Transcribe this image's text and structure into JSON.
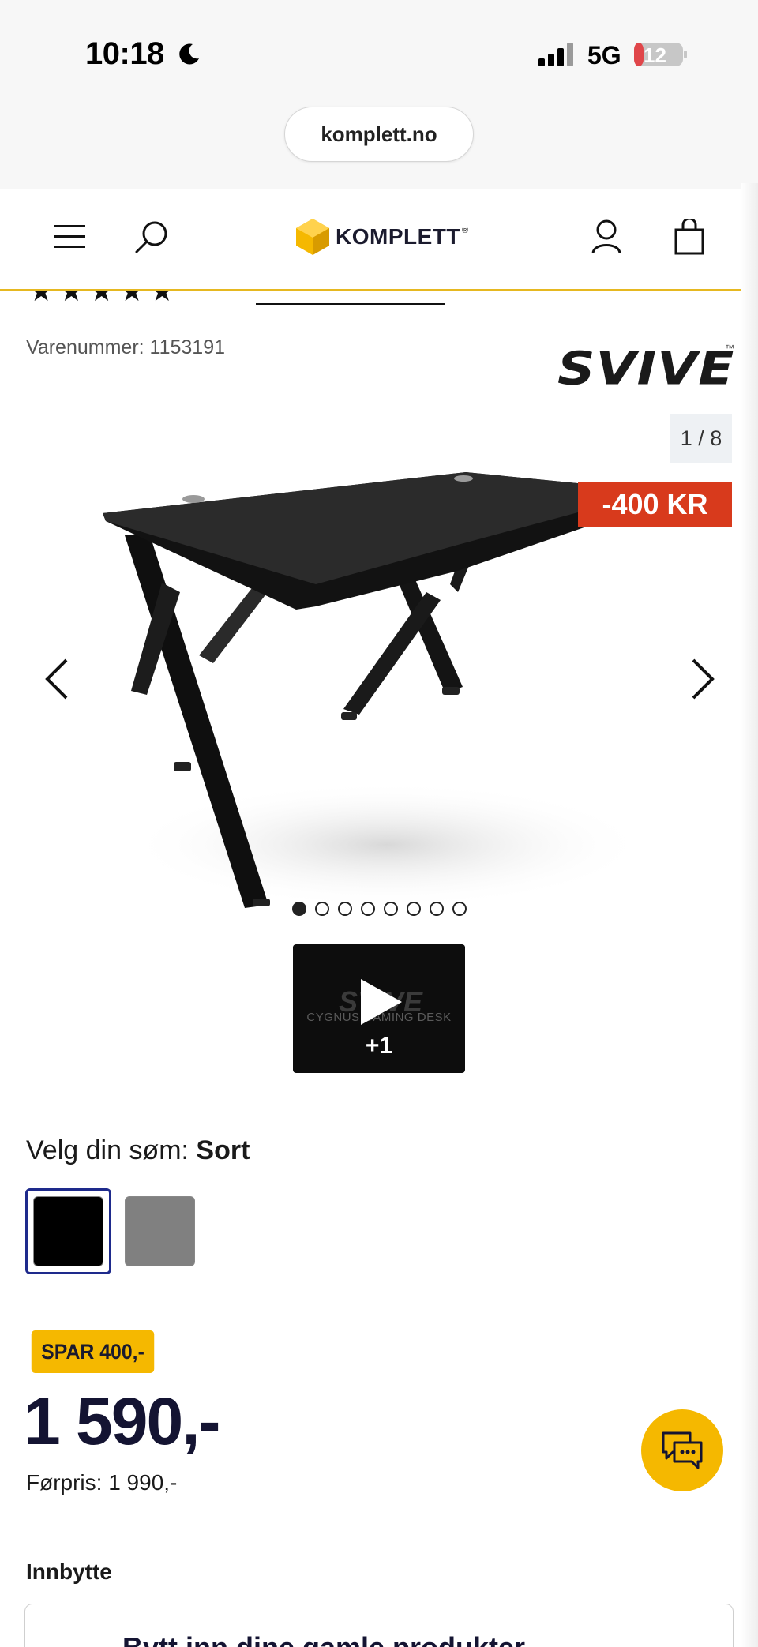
{
  "status_bar": {
    "time": "10:18",
    "network": "5G",
    "battery": "12"
  },
  "browser": {
    "url": "komplett.no"
  },
  "header": {
    "logo_text": "KOMPLETT",
    "logo_mark": "®"
  },
  "rating": {
    "stars": "★★★★★"
  },
  "product": {
    "sku_label": "Varenummer: 1153191",
    "brand": "SVIVE",
    "brand_tm": "™",
    "image_counter": "1 / 8",
    "discount_badge": "-400 KR",
    "video_count": "+1",
    "video_caption": "CYGNUS GAMING DESK",
    "video_logo": "SVIVE"
  },
  "variant": {
    "label_prefix": "Velg din søm: ",
    "selected": "Sort",
    "options": [
      {
        "name": "Sort",
        "color": "#000000"
      },
      {
        "name": "Grå",
        "color": "#808080"
      }
    ]
  },
  "pricing": {
    "save_badge": "SPAR 400,-",
    "price": "1 590,-",
    "previous_price": "Førpris: 1 990,-"
  },
  "tradein": {
    "title": "Innbytte",
    "box_text": "Bytt inn dine gamle produkter"
  },
  "colors": {
    "accent": "#f5b800",
    "discount": "#d83a1c",
    "price": "#141432",
    "selected_border": "#1e2a8c"
  }
}
